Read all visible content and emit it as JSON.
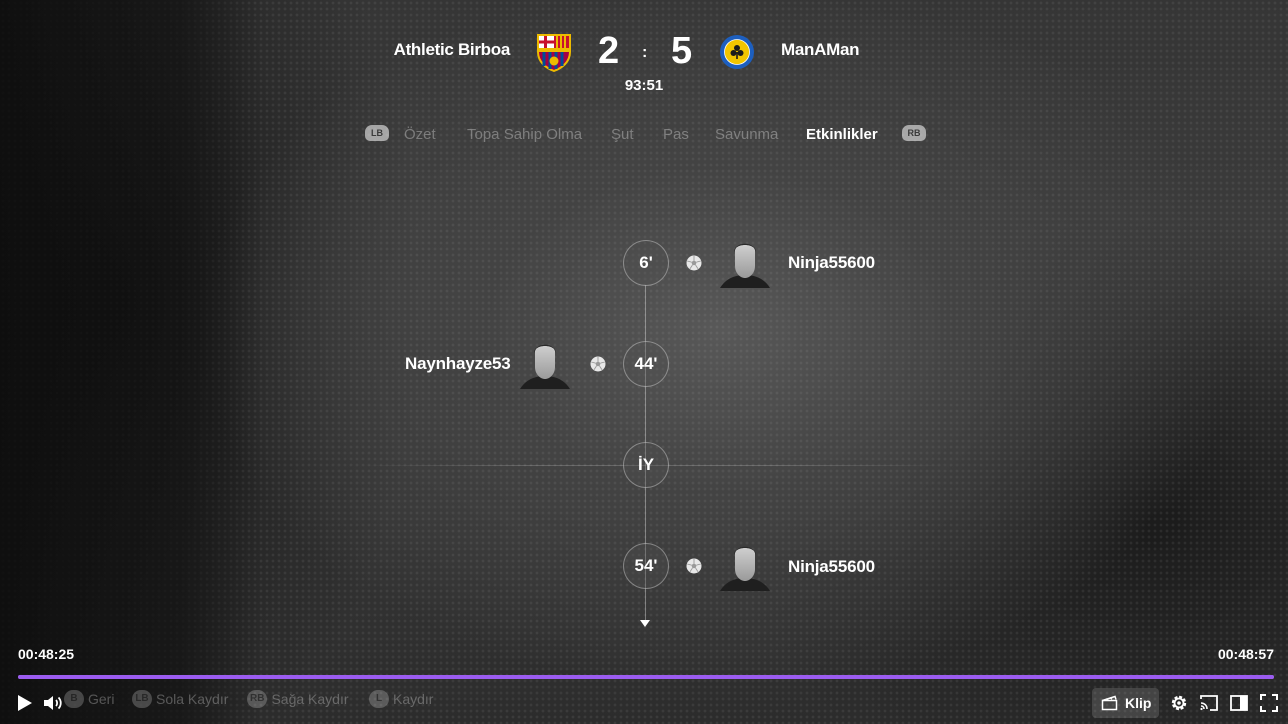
{
  "match": {
    "home_team": "Athletic Birboa",
    "away_team": "ManAMan",
    "home_score": "2",
    "away_score": "5",
    "separator": ":",
    "clock": "93:51"
  },
  "tabs": {
    "prev_key": "LB",
    "next_key": "RB",
    "items": [
      "Özet",
      "Topa Sahip Olma",
      "Şut",
      "Pas",
      "Savunma",
      "Etkinlikler"
    ],
    "active": "Etkinlikler"
  },
  "events": [
    {
      "minute": "6'",
      "player": "Ninja55600",
      "side": "away",
      "type": "goal"
    },
    {
      "minute": "44'",
      "player": "Naynhayze53",
      "side": "home",
      "type": "goal"
    },
    {
      "minute": "İY",
      "type": "half-time"
    },
    {
      "minute": "54'",
      "player": "Ninja55600",
      "side": "away",
      "type": "goal"
    }
  ],
  "player": {
    "current_time": "00:48:25",
    "total_time": "00:48:57",
    "progress": 1.0,
    "accent_color": "#9b5cf0",
    "hints": [
      {
        "key": "B",
        "label": "Geri"
      },
      {
        "key": "LB",
        "label": "Sola Kaydır"
      },
      {
        "key": "RB",
        "label": "Sağa Kaydır"
      },
      {
        "key": "L",
        "label": "Kaydır"
      }
    ],
    "clip_label": "Klip",
    "icons": [
      "play-icon",
      "volume-icon",
      "clip-icon",
      "settings-icon",
      "cast-icon",
      "theater-mode-icon",
      "fullscreen-icon"
    ]
  }
}
